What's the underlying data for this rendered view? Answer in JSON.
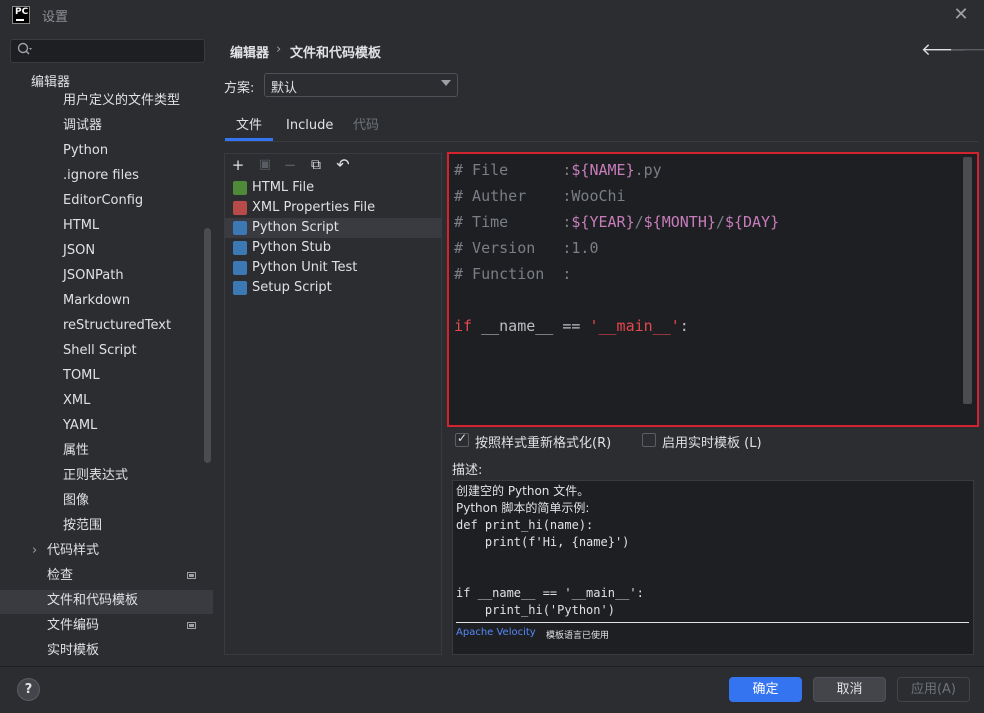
{
  "window": {
    "title": "设置",
    "logo_text": "PC"
  },
  "search": {
    "placeholder": ""
  },
  "sidebar": {
    "items": [
      {
        "label": "编辑器",
        "level": 0,
        "selected": false
      },
      {
        "label": "用户定义的文件类型",
        "level": 2
      },
      {
        "label": "调试器",
        "level": 2
      },
      {
        "label": "Python",
        "level": 2
      },
      {
        "label": ".ignore files",
        "level": 2
      },
      {
        "label": "EditorConfig",
        "level": 2
      },
      {
        "label": "HTML",
        "level": 2
      },
      {
        "label": "JSON",
        "level": 2
      },
      {
        "label": "JSONPath",
        "level": 2
      },
      {
        "label": "Markdown",
        "level": 2
      },
      {
        "label": "reStructuredText",
        "level": 2
      },
      {
        "label": "Shell Script",
        "level": 2
      },
      {
        "label": "TOML",
        "level": 2
      },
      {
        "label": "XML",
        "level": 2
      },
      {
        "label": "YAML",
        "level": 2
      },
      {
        "label": "属性",
        "level": 2
      },
      {
        "label": "正则表达式",
        "level": 2
      },
      {
        "label": "图像",
        "level": 2
      },
      {
        "label": "按范围",
        "level": 2
      },
      {
        "label": "代码样式",
        "level": 1,
        "expandable": true
      },
      {
        "label": "检查",
        "level": 1,
        "badge": true
      },
      {
        "label": "文件和代码模板",
        "level": 1,
        "selected": true
      },
      {
        "label": "文件编码",
        "level": 1,
        "badge": true
      },
      {
        "label": "实时模板",
        "level": 1
      }
    ]
  },
  "breadcrumb": {
    "parent": "编辑器",
    "separator": "›",
    "current": "文件和代码模板"
  },
  "scheme": {
    "label": "方案:",
    "value": "默认"
  },
  "tabs": [
    {
      "label": "文件",
      "active": true
    },
    {
      "label": "Include",
      "active": false
    },
    {
      "label": "代码",
      "active": false,
      "disabled": true
    }
  ],
  "toolbar": {
    "add": "+",
    "copy_disabled": "▣",
    "remove": "−",
    "duplicate": "⧉",
    "reset": "↶"
  },
  "templates": [
    {
      "label": "HTML File",
      "icon_color": "#4f8a3b",
      "selected": false
    },
    {
      "label": "XML Properties File",
      "icon_color": "#b84a4a",
      "selected": false
    },
    {
      "label": "Python Script",
      "icon_color": "#3b78b4",
      "selected": true
    },
    {
      "label": "Python Stub",
      "icon_color": "#3b78b4",
      "selected": false
    },
    {
      "label": "Python Unit Test",
      "icon_color": "#3b78b4",
      "selected": false
    },
    {
      "label": "Setup Script",
      "icon_color": "#3b78b4",
      "selected": false
    }
  ],
  "editor": {
    "lines": [
      [
        {
          "t": "# File      :",
          "c": "c-comment"
        },
        {
          "t": "${NAME}",
          "c": "c-var"
        },
        {
          "t": ".py",
          "c": "c-comment"
        }
      ],
      [
        {
          "t": "# Auther    :WooChi",
          "c": "c-comment"
        }
      ],
      [
        {
          "t": "# Time      :",
          "c": "c-comment"
        },
        {
          "t": "${YEAR}",
          "c": "c-var"
        },
        {
          "t": "/",
          "c": "c-comment"
        },
        {
          "t": "${MONTH}",
          "c": "c-var"
        },
        {
          "t": "/",
          "c": "c-comment"
        },
        {
          "t": "${DAY}",
          "c": "c-var"
        }
      ],
      [
        {
          "t": "# Version   :1.0",
          "c": "c-comment"
        }
      ],
      [
        {
          "t": "# Function  :",
          "c": "c-comment"
        }
      ],
      [
        {
          "t": "",
          "c": "c-white"
        }
      ],
      [
        {
          "t": "if",
          "c": "c-red"
        },
        {
          "t": " __name__ == ",
          "c": "c-white"
        },
        {
          "t": "'__main__'",
          "c": "c-red"
        },
        {
          "t": ":",
          "c": "c-white"
        }
      ]
    ]
  },
  "options": {
    "reformat_label": "按照样式重新格式化(R)",
    "reformat_checked": true,
    "live_template_label": "启用实时模板 (L)",
    "live_template_checked": false
  },
  "description": {
    "label": "描述:",
    "lines": [
      {
        "text": "创建空的 Python 文件。",
        "mono": false
      },
      {
        "text": "Python 脚本的简单示例:",
        "mono": false
      },
      {
        "text": "def print_hi(name):",
        "mono": true
      },
      {
        "text": "    print(f'Hi, {name}')",
        "mono": true
      },
      {
        "text": "",
        "mono": true
      },
      {
        "text": "",
        "mono": true
      },
      {
        "text": "if __name__ == '__main__':",
        "mono": true
      },
      {
        "text": "    print_hi('Python')",
        "mono": true
      }
    ],
    "link": "Apache Velocity",
    "link_suffix": "模板语言已使用"
  },
  "buttons": {
    "help": "?",
    "ok": "确定",
    "cancel": "取消",
    "apply": "应用(A)"
  },
  "colors": {
    "accent": "#3574f0",
    "highlight_border": "#d3232f"
  }
}
